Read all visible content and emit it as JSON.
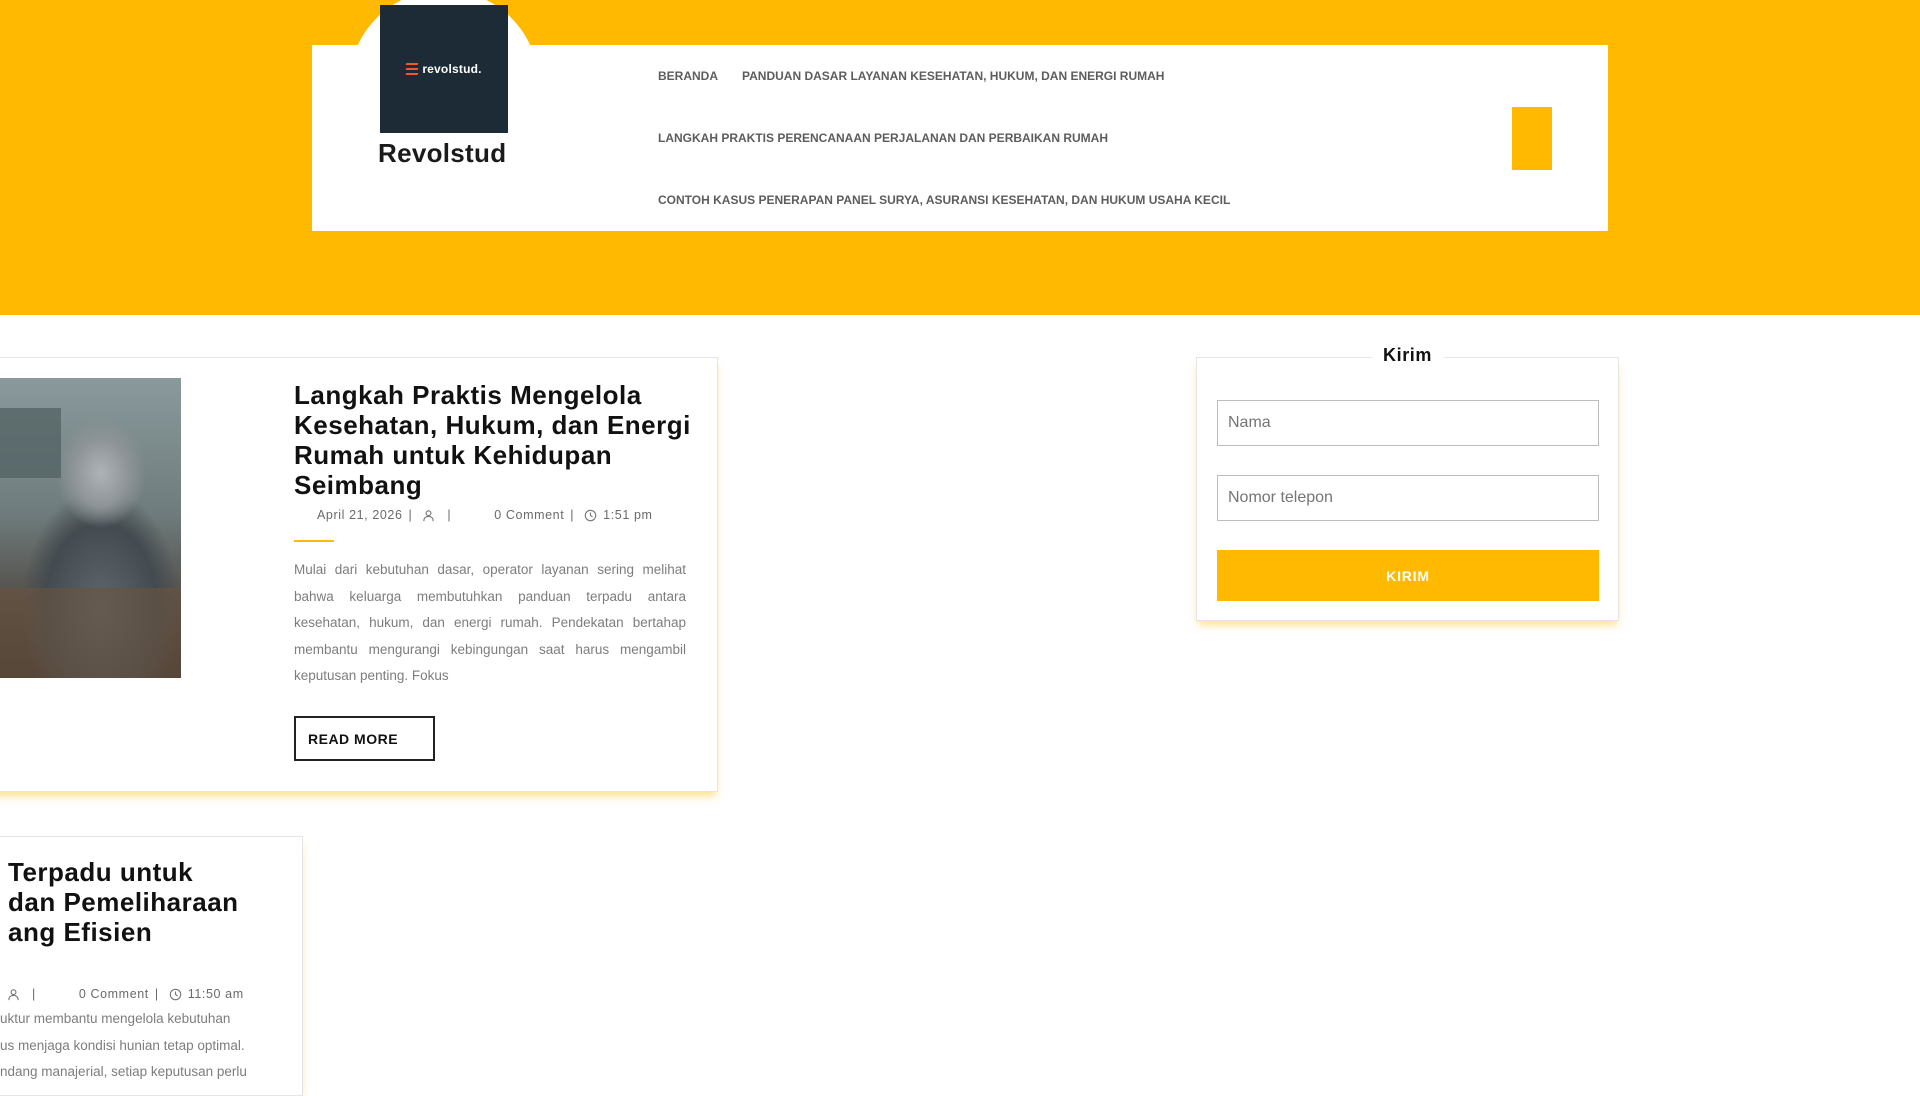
{
  "site": {
    "logo_text": "revolstud.",
    "title": "Revolstud"
  },
  "nav": {
    "items": [
      {
        "label": "BERANDA"
      },
      {
        "label": "PANDUAN DASAR LAYANAN KESEHATAN, HUKUM, DAN ENERGI RUMAH"
      },
      {
        "label": "LANGKAH PRAKTIS PERENCANAAN PERJALANAN DAN PERBAIKAN RUMAH"
      },
      {
        "label": "CONTOH KASUS PENERAPAN PANEL SURYA, ASURANSI KESEHATAN, DAN HUKUM USAHA KECIL"
      }
    ]
  },
  "posts": [
    {
      "title": "Langkah Praktis Mengelola Kesehatan, Hukum, dan Energi Rumah untuk Kehidupan Seimbang",
      "date": "April 21, 2026",
      "comments": "0 Comment",
      "time": "1:51 pm",
      "excerpt": "Mulai dari kebutuhan dasar, operator layanan sering melihat bahwa keluarga membutuhkan panduan terpadu antara kesehatan, hukum, dan energi rumah. Pendekatan bertahap membantu mengurangi kebingungan saat harus mengambil keputusan penting. Fokus",
      "read_more": "READ MORE"
    },
    {
      "title_lines": [
        "Terpadu untuk",
        "dan Pemeliharaan",
        "ang Efisien"
      ],
      "comments": "0 Comment",
      "time": "11:50 am",
      "excerpt_lines": [
        "uktur   membantu   mengelola   kebutuhan",
        "us  menjaga  kondisi  hunian  tetap  optimal.",
        "ndang  manajerial,  setiap  keputusan  perlu"
      ]
    }
  ],
  "widget": {
    "title": "Kirim",
    "name_placeholder": "Nama",
    "phone_placeholder": "Nomor telepon",
    "submit_label": "KIRIM"
  },
  "colors": {
    "accent": "#ffba00",
    "logo_bg": "#1d2b36",
    "logo_mark": "#f05a28"
  }
}
